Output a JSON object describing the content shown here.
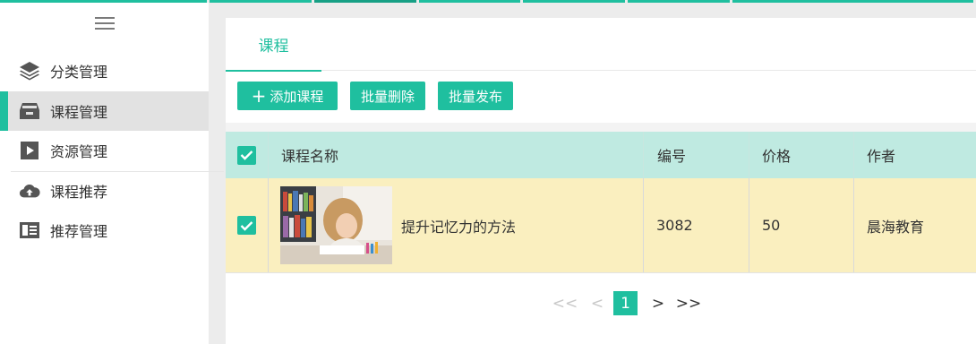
{
  "colors": {
    "accent": "#1fbf9f",
    "header_row": "#bfeae1",
    "data_row": "#faefbf"
  },
  "sidebar": {
    "menu_icon": "hamburger-icon",
    "items": [
      {
        "label": "分类管理",
        "icon": "layers-icon",
        "active": false
      },
      {
        "label": "课程管理",
        "icon": "inbox-icon",
        "active": true
      },
      {
        "label": "资源管理",
        "icon": "play-icon",
        "active": false
      },
      {
        "label": "课程推荐",
        "icon": "cloud-upload-icon",
        "active": false
      },
      {
        "label": "推荐管理",
        "icon": "book-icon",
        "active": false
      }
    ]
  },
  "main": {
    "tabs": [
      {
        "label": "课程",
        "active": true
      }
    ],
    "toolbar": {
      "add_label": "添加课程",
      "batch_delete_label": "批量删除",
      "batch_publish_label": "批量发布"
    },
    "table": {
      "header_checked": true,
      "columns": [
        "课程名称",
        "编号",
        "价格",
        "作者"
      ],
      "rows": [
        {
          "checked": true,
          "name": "提升记忆力的方法",
          "code": "3082",
          "price": "50",
          "author": "晨海教育"
        }
      ]
    },
    "pagination": {
      "first": "<<",
      "prev": "<",
      "current": "1",
      "next": ">",
      "last": ">>"
    }
  }
}
